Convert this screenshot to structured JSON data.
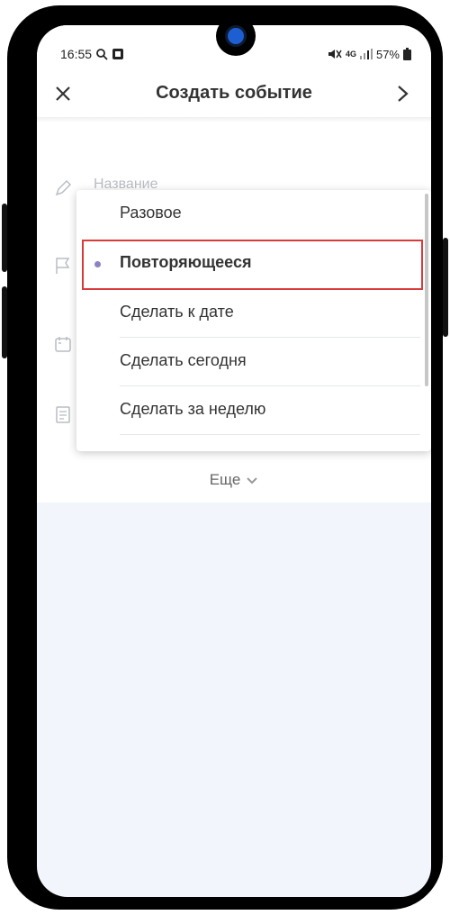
{
  "status_bar": {
    "time": "16:55",
    "network": "4G",
    "battery": "57%"
  },
  "header": {
    "title": "Создать событие"
  },
  "form": {
    "name_placeholder": "Название",
    "more_label": "Еще"
  },
  "dropdown": {
    "selected_index": 1,
    "items": [
      {
        "label": "Разовое"
      },
      {
        "label": "Повторяющееся"
      },
      {
        "label": "Сделать к дате"
      },
      {
        "label": "Сделать сегодня"
      },
      {
        "label": "Сделать за неделю"
      }
    ]
  },
  "colors": {
    "selected_dot": "#8c83c4",
    "highlight_border": "#d93a3a",
    "screen_background": "#f2f5fb"
  }
}
